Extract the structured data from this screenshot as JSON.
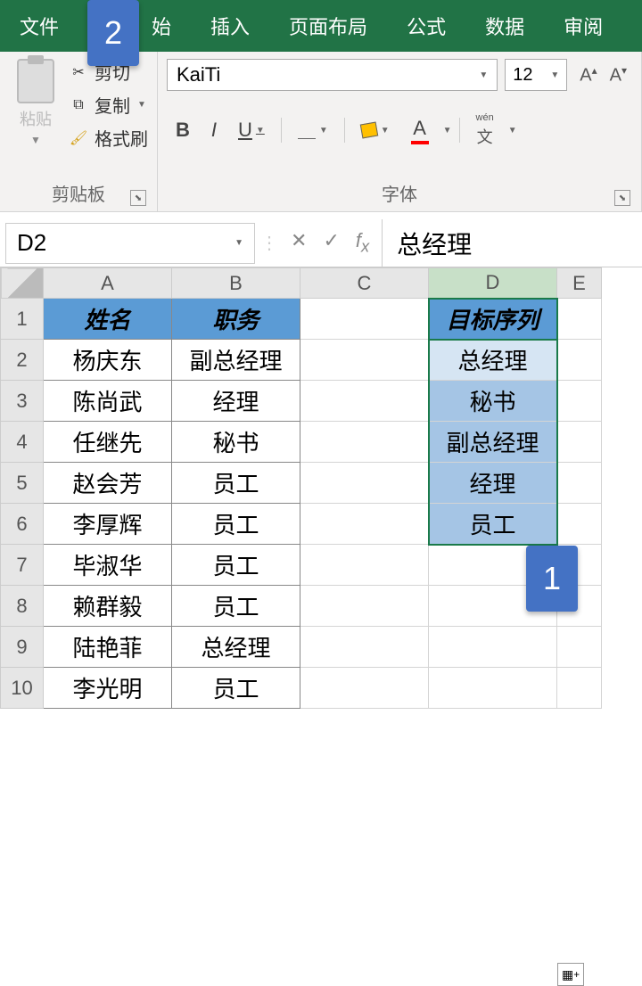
{
  "tabs": {
    "file": "文件",
    "home": "始",
    "insert": "插入",
    "layout": "页面布局",
    "formula": "公式",
    "data": "数据",
    "review": "审阅"
  },
  "callouts": {
    "one": "1",
    "two": "2"
  },
  "clipboard": {
    "paste": "粘贴",
    "cut": "剪切",
    "copy": "复制",
    "format_painter": "格式刷",
    "group_label": "剪贴板"
  },
  "font": {
    "name": "KaiTi",
    "size": "12",
    "group_label": "字体",
    "bold": "B",
    "italic": "I",
    "underline": "U",
    "grow": "A",
    "shrink": "A",
    "fontcolor_a": "A",
    "wen": "wén",
    "wen_zi": "文"
  },
  "namebox": {
    "ref": "D2"
  },
  "formula": {
    "value": "总经理"
  },
  "columns": [
    "A",
    "B",
    "C",
    "D",
    "E"
  ],
  "rows": [
    "1",
    "2",
    "3",
    "4",
    "5",
    "6",
    "7",
    "8",
    "9",
    "10"
  ],
  "headers": {
    "name": "姓名",
    "position": "职务",
    "target": "目标序列"
  },
  "table_ab": [
    {
      "name": "杨庆东",
      "pos": "副总经理"
    },
    {
      "name": "陈尚武",
      "pos": "经理"
    },
    {
      "name": "任继先",
      "pos": "秘书"
    },
    {
      "name": "赵会芳",
      "pos": "员工"
    },
    {
      "name": "李厚辉",
      "pos": "员工"
    },
    {
      "name": "毕淑华",
      "pos": "员工"
    },
    {
      "name": "赖群毅",
      "pos": "员工"
    },
    {
      "name": "陆艳菲",
      "pos": "总经理"
    },
    {
      "name": "李光明",
      "pos": "员工"
    }
  ],
  "target_list": [
    "总经理",
    "秘书",
    "副总经理",
    "经理",
    "员工"
  ]
}
